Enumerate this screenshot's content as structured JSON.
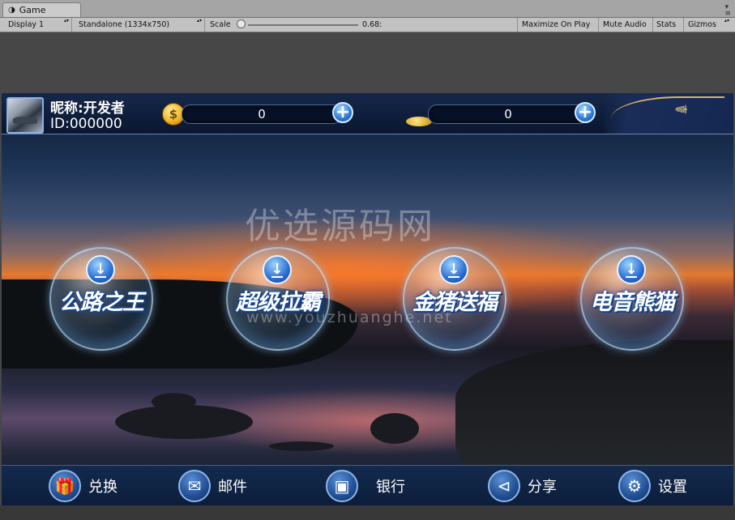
{
  "editor": {
    "tab": {
      "icon": "unity-game-icon",
      "label": "Game"
    },
    "toolbar": {
      "display": "Display 1",
      "resolution": "Standalone (1334x750)",
      "scale_label": "Scale",
      "scale_value": "0.68:",
      "maximize": "Maximize On Play",
      "mute": "Mute Audio",
      "stats": "Stats",
      "gizmos": "Gizmos"
    }
  },
  "game": {
    "user": {
      "nickname": "昵称:开发者",
      "id": "ID:000000"
    },
    "currencies": [
      {
        "icon": "gold-coin-icon",
        "value": "0"
      },
      {
        "icon": "treasure-chest-icon",
        "value": "0"
      }
    ],
    "games": [
      {
        "name": "公路之王"
      },
      {
        "name": "超级拉霸"
      },
      {
        "name": "金猪送福"
      },
      {
        "name": "电音熊猫"
      }
    ],
    "bottom_nav": [
      {
        "icon": "gift-icon",
        "label": "兑换"
      },
      {
        "icon": "mail-icon",
        "label": "邮件"
      },
      {
        "icon": "safe-icon",
        "label": "银行"
      },
      {
        "icon": "share-icon",
        "label": "分享"
      },
      {
        "icon": "gear-icon",
        "label": "设置"
      }
    ],
    "watermark": {
      "text": "优选源码网",
      "url": "www.youzhuanghe.net"
    }
  },
  "colors": {
    "editor_chrome": "#c2c2c2",
    "bar_blue": "#0e1d3a",
    "accent_blue": "#2c79d6",
    "sunset_orange": "#e3792f"
  }
}
